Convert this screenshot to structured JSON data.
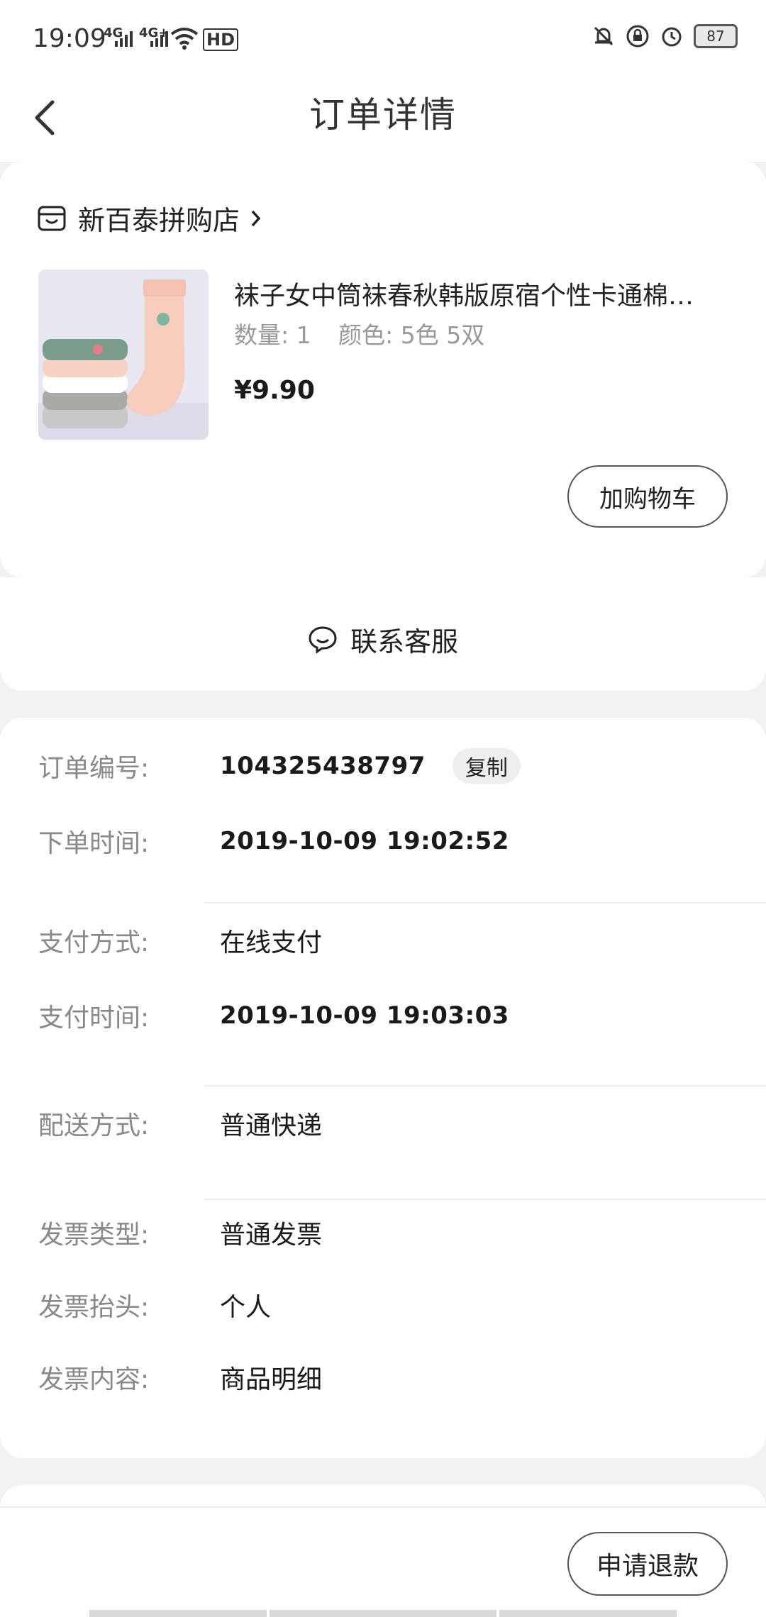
{
  "status_bar": {
    "time": "19:09",
    "net1": "4G",
    "net2": "4G+",
    "hd": "HD",
    "battery": "87"
  },
  "header": {
    "title": "订单详情"
  },
  "shop": {
    "name": "新百泰拼购店"
  },
  "product": {
    "title": "袜子女中筒袜春秋韩版原宿个性卡通棉…",
    "quantity": "数量: 1",
    "color": "颜色: 5色 5双",
    "price": "¥9.90",
    "add_cart_label": "加购物车"
  },
  "service": {
    "label": "联系客服"
  },
  "order": {
    "number_label": "订单编号:",
    "number_value": "104325438797",
    "copy_label": "复制",
    "time_label": "下单时间:",
    "time_value": "2019-10-09 19:02:52",
    "pay_method_label": "支付方式:",
    "pay_method_value": "在线支付",
    "pay_time_label": "支付时间:",
    "pay_time_value": "2019-10-09 19:03:03",
    "delivery_label": "配送方式:",
    "delivery_value": "普通快递",
    "invoice_type_label": "发票类型:",
    "invoice_type_value": "普通发票",
    "invoice_title_label": "发票抬头:",
    "invoice_title_value": "个人",
    "invoice_content_label": "发票内容:",
    "invoice_content_value": "商品明细"
  },
  "footer": {
    "refund_label": "申请退款"
  }
}
